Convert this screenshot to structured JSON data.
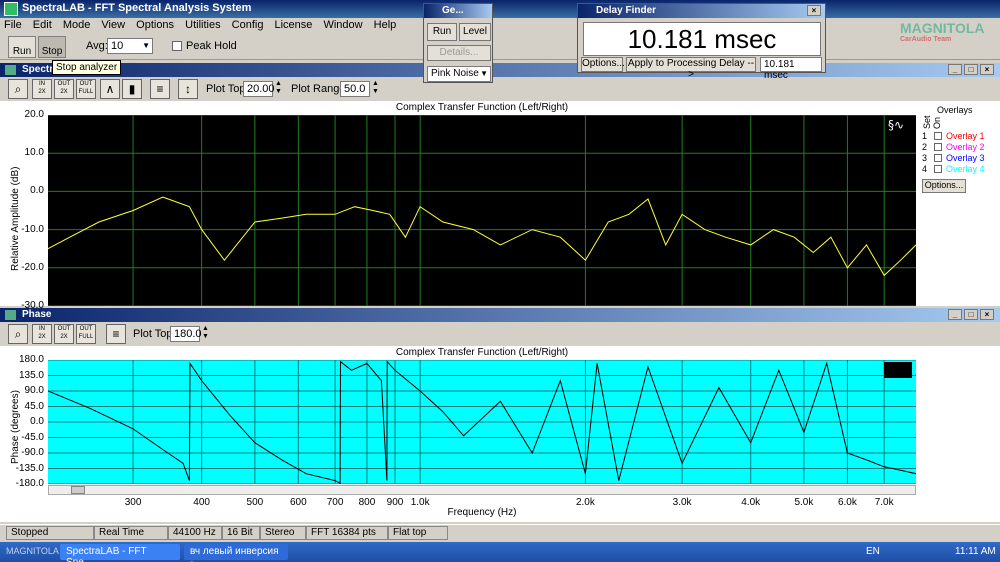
{
  "app": {
    "title": "SpectraLAB - FFT Spectral Analysis System"
  },
  "menu": [
    "File",
    "Edit",
    "Mode",
    "View",
    "Options",
    "Utilities",
    "Config",
    "License",
    "Window",
    "Help"
  ],
  "toolbar": {
    "run_label": "Run",
    "stop_label": "Stop",
    "avg_label": "Avg:",
    "avg_value": "10",
    "peak_hold_label": "Peak Hold",
    "tooltip": "Stop analyzer"
  },
  "generator": {
    "title": "Ge...",
    "run": "Run",
    "level": "Level",
    "details": "Details...",
    "signal": "Pink Noise"
  },
  "delay_finder": {
    "title": "Delay Finder",
    "reading": "10.181 msec",
    "options": "Options...",
    "apply": "Apply to Processing Delay -->",
    "value": "10.181 msec"
  },
  "watermark": {
    "brand": "MAGNITOLA",
    "sub": "CarAudio Team"
  },
  "spectrum": {
    "panel_title": "Spectrum",
    "plot_top_label": "Plot Top:",
    "plot_top": "20.00",
    "plot_range_label": "Plot Range:",
    "plot_range": "50.0",
    "overlays": {
      "header": "Overlays",
      "set_label": "Set",
      "on_label": "On",
      "items": [
        "Overlay 1",
        "Overlay 2",
        "Overlay 3",
        "Overlay 4"
      ],
      "colors": [
        "#ff0000",
        "#ff00ff",
        "#0000ff",
        "#00ffff"
      ],
      "numbers": [
        "1",
        "2",
        "3",
        "4"
      ],
      "options": "Options..."
    },
    "colors": {
      "background": "#000000",
      "grid": "#1f7f1f",
      "trace": "#ffff33"
    }
  },
  "phase": {
    "panel_title": "Phase",
    "plot_top_label": "Plot Top:",
    "plot_top": "180.0",
    "colors": {
      "background": "#00ffff",
      "grid": "#008080",
      "trace": "#000000"
    }
  },
  "chart_data": [
    {
      "type": "line",
      "title": "Complex Transfer Function (Left/Right)",
      "ylabel": "Relative Amplitude (dB)",
      "xlabel": "",
      "ylim": [
        -30,
        20
      ],
      "y_ticks": [
        "20.0",
        "10.0",
        "0.0",
        "-10.0",
        "-20.0",
        "-30.0"
      ],
      "x": [
        210,
        230,
        260,
        300,
        340,
        380,
        400,
        440,
        500,
        560,
        620,
        700,
        760,
        820,
        880,
        940,
        1000,
        1100,
        1250,
        1400,
        1600,
        1800,
        2000,
        2200,
        2400,
        2600,
        2800,
        3000,
        3300,
        3600,
        4000,
        4400,
        4800,
        5200,
        5600,
        6000,
        6500,
        7000,
        7500,
        8000
      ],
      "series": [
        {
          "values": [
            -15,
            -12,
            -8,
            -5,
            -1.5,
            -4,
            -10,
            -18,
            -8,
            -7,
            -6,
            -6,
            -4,
            -5,
            -6,
            -12,
            -4,
            -8,
            -10,
            -14,
            -10,
            -12,
            -18,
            -8,
            -6,
            -2,
            -14,
            -6,
            -10,
            -12,
            -14,
            -10,
            -12,
            -16,
            -12,
            -20,
            -14,
            -22,
            -18,
            -14
          ]
        }
      ]
    },
    {
      "type": "line",
      "title": "Complex Transfer Function (Left/Right)",
      "ylabel": "Phase (degrees)",
      "xlabel": "Frequency (Hz)",
      "ylim": [
        -180,
        180
      ],
      "y_ticks": [
        "180.0",
        "135.0",
        "90.0",
        "45.0",
        "0.0",
        "-45.0",
        "-90.0",
        "-135.0",
        "-180.0"
      ],
      "x_ticks": [
        "300",
        "400",
        "500",
        "600",
        "700",
        "800",
        "900",
        "1.0k",
        "2.0k",
        "3.0k",
        "4.0k",
        "5.0k",
        "6.0k",
        "7.0k"
      ],
      "xlim": [
        210,
        8000
      ],
      "x": [
        210,
        250,
        300,
        340,
        370,
        380,
        381,
        400,
        450,
        500,
        560,
        620,
        700,
        715,
        716,
        750,
        800,
        850,
        870,
        871,
        900,
        1000,
        1100,
        1200,
        1400,
        1600,
        1800,
        2000,
        2100,
        2300,
        2600,
        3000,
        3500,
        4000,
        4500,
        5000,
        5500,
        6000,
        6500,
        7000,
        7500,
        8000
      ],
      "series": [
        {
          "values": [
            90,
            40,
            -20,
            -80,
            -120,
            -170,
            170,
            120,
            20,
            -60,
            -110,
            -150,
            -170,
            -178,
            175,
            150,
            170,
            120,
            -170,
            175,
            150,
            90,
            30,
            -40,
            60,
            -90,
            120,
            -150,
            170,
            -170,
            160,
            -120,
            100,
            -60,
            150,
            -30,
            170,
            -90,
            -110,
            -130,
            -140,
            -150
          ]
        }
      ]
    }
  ],
  "status": {
    "state": "Stopped",
    "mode": "Real Time",
    "rate": "44100 Hz",
    "bits": "16 Bit",
    "channels": "Stereo",
    "fft": "FFT 16384 pts",
    "window": "Flat top"
  },
  "taskbar": {
    "tasks": [
      "SpectraLAB - FFT Spe...",
      "вч левый инверсия - ..."
    ],
    "lang": "EN",
    "clock": "11:11 AM",
    "watermark_text": "MAGNITOLA SPECTRALAB.NET"
  }
}
